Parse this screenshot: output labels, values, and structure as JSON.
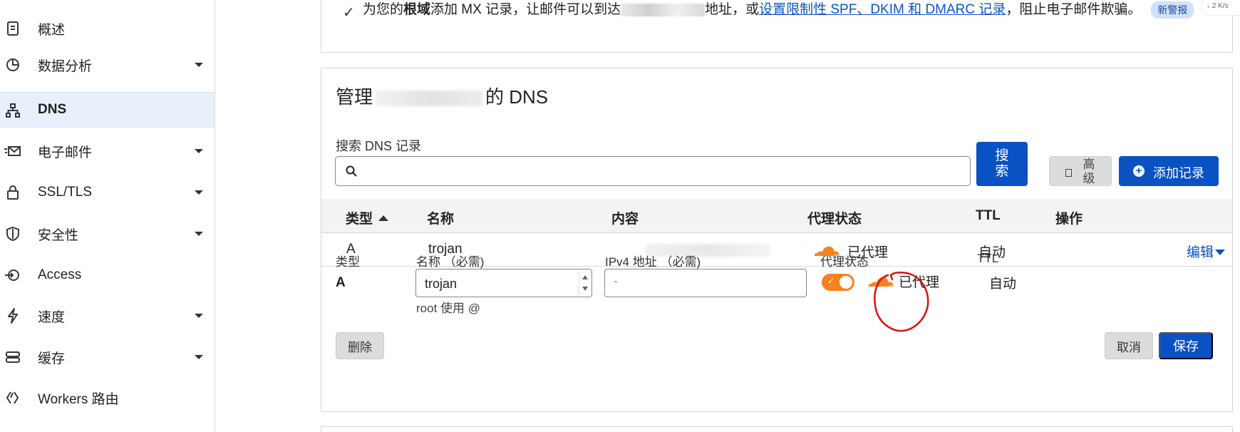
{
  "sidebar": {
    "items": [
      {
        "label": "概述",
        "icon": "document-icon",
        "has_caret": false
      },
      {
        "label": "数据分析",
        "icon": "pie-chart-icon",
        "has_caret": true
      },
      {
        "label": "DNS",
        "icon": "network-icon",
        "has_caret": false,
        "active": true
      },
      {
        "label": "电子邮件",
        "icon": "email-icon",
        "has_caret": true
      },
      {
        "label": "SSL/TLS",
        "icon": "lock-icon",
        "has_caret": true
      },
      {
        "label": "安全性",
        "icon": "shield-icon",
        "has_caret": true
      },
      {
        "label": "Access",
        "icon": "access-icon",
        "has_caret": false
      },
      {
        "label": "速度",
        "icon": "lightning-icon",
        "has_caret": true
      },
      {
        "label": "缓存",
        "icon": "database-icon",
        "has_caret": true
      },
      {
        "label": "Workers 路由",
        "icon": "workers-icon",
        "has_caret": false
      }
    ],
    "more": "...."
  },
  "banner": {
    "text_1": "为您的",
    "text_bold": "根域",
    "text_2": "添加 MX 记录，让邮件可以到达",
    "text_3": "地址，或",
    "link": "设置限制性 SPF、DKIM 和 DMARC 记录",
    "text_4": "，阻止电子邮件欺骗。",
    "badge": "新警报"
  },
  "dns": {
    "title_prefix": "管理",
    "title_suffix": "的 DNS",
    "search_label": "搜索 DNS 记录",
    "search_placeholder": "",
    "search_button": "搜索",
    "advanced_button": "高级",
    "add_button": "添加记录",
    "columns": {
      "type": "类型",
      "name": "名称",
      "content": "内容",
      "proxy": "代理状态",
      "ttl": "TTL",
      "actions": "操作"
    },
    "record": {
      "type": "A",
      "name": "trojan",
      "proxy": "已代理",
      "ttl": "自动",
      "edit": "编辑"
    },
    "form": {
      "type_label": "类型",
      "type_value": "A",
      "name_label": "名称 （必需)",
      "name_value": "trojan",
      "name_hint": "root 使用 @",
      "ip_label": "IPv4 地址 （必需)",
      "ip_value": "-",
      "proxy_label": "代理状态",
      "proxy_value": "已代理",
      "ttl_label": "TTL",
      "ttl_value": "自动",
      "delete": "删除",
      "cancel": "取消",
      "save": "保存"
    }
  },
  "net_speed": {
    "value": "2",
    "unit": "K/s"
  },
  "colors": {
    "accent": "#0a51c4",
    "orange": "#f6821f",
    "annotation": "#e01010"
  }
}
